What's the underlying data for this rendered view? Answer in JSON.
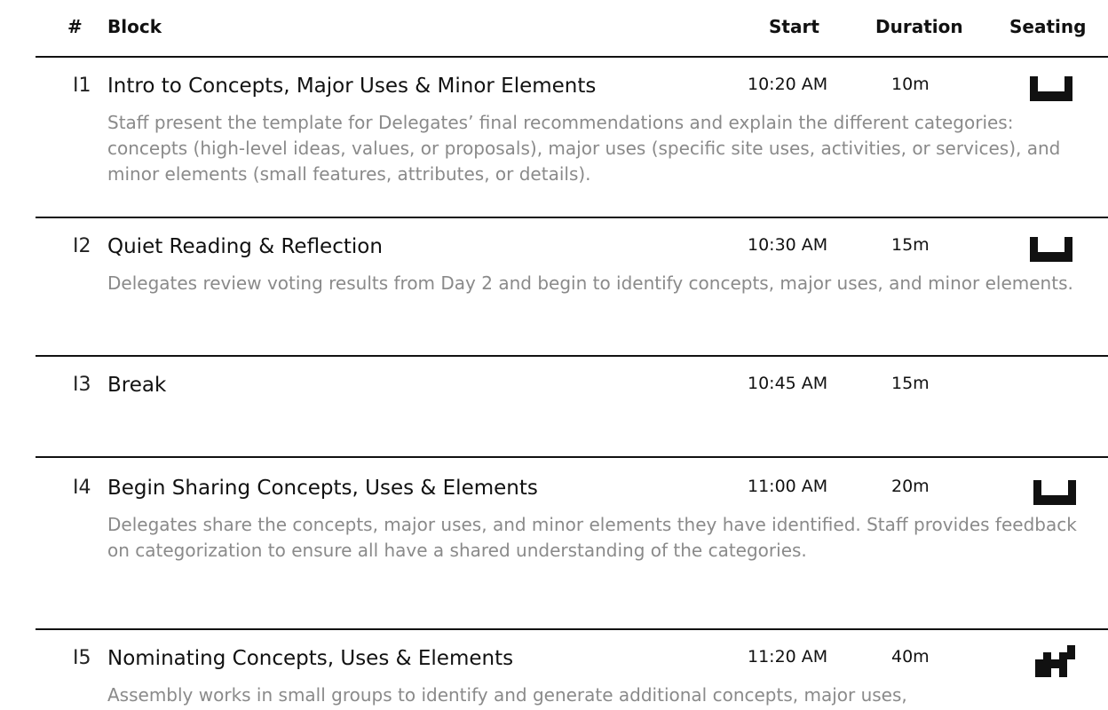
{
  "header": {
    "num_label": "#",
    "block_label": "Block",
    "start_label": "Start",
    "duration_label": "Duration",
    "seating_label": "Seating"
  },
  "rows": [
    {
      "num": "I1",
      "title": "Intro to Concepts, Major Uses & Minor Elements",
      "start": "10:20 AM",
      "duration": "10m",
      "seating_icon": "theater-seating-icon",
      "description": "Staff present the template for Delegates’ final recommendations and explain the different categories: concepts (high-level ideas, values, or proposals), major uses (specific site uses, activities, or services), and minor elements (small features, attributes, or details)."
    },
    {
      "num": "I2",
      "title": "Quiet Reading & Reflection",
      "start": "10:30 AM",
      "duration": "15m",
      "seating_icon": "theater-seating-icon",
      "description": "Delegates review voting results from Day 2 and begin to identify concepts, major uses, and minor elements."
    },
    {
      "num": "I3",
      "title": "Break",
      "start": "10:45 AM",
      "duration": "15m",
      "seating_icon": "",
      "description": ""
    },
    {
      "num": "I4",
      "title": "Begin Sharing Concepts, Uses & Elements",
      "start": "11:00 AM",
      "duration": "20m",
      "seating_icon": "theater-seating-icon",
      "description": "Delegates share the concepts, major uses, and minor elements they have identified. Staff provides feedback on categorization to ensure all have a shared understanding of the categories."
    },
    {
      "num": "I5",
      "title": "Nominating Concepts, Uses & Elements",
      "start": "11:20 AM",
      "duration": "40m",
      "seating_icon": "small-groups-seating-icon",
      "description": "Assembly works in small groups to identify and generate additional concepts, major uses,"
    }
  ]
}
